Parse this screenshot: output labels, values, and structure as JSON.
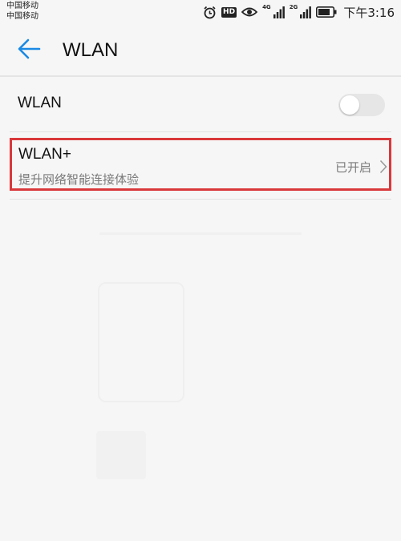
{
  "status_bar": {
    "carrier_1": "中国移动",
    "carrier_2": "中国移动",
    "hd_badge": "HD",
    "sim1_network": "4G",
    "sim2_network": "2G",
    "time": "下午3:16",
    "icons": [
      "alarm-icon",
      "eye-comfort-icon",
      "signal-icon",
      "battery-icon"
    ]
  },
  "app_bar": {
    "title": "WLAN",
    "back_icon": "arrow-left-icon",
    "accent_color": "#1a8ae5"
  },
  "wlan_row": {
    "label": "WLAN",
    "toggle_on": false
  },
  "wlan_plus_row": {
    "title": "WLAN+",
    "subtitle": "提升网络智能连接体验",
    "status": "已开启",
    "chevron_icon": "chevron-right-icon",
    "highlight_color": "#d9383b"
  }
}
